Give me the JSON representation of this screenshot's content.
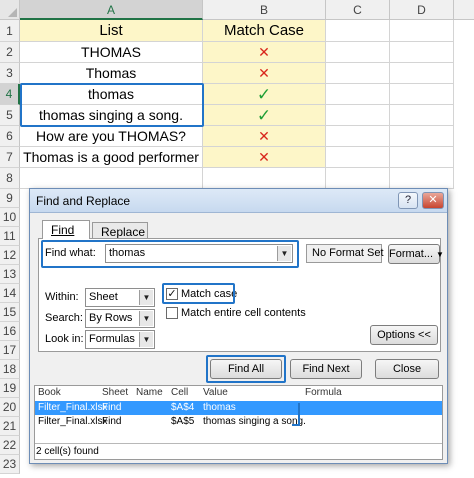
{
  "spreadsheet": {
    "columns": [
      "A",
      "B",
      "C",
      "D"
    ],
    "rows": [
      "1",
      "2",
      "3",
      "4",
      "5",
      "6",
      "7",
      "8",
      "9",
      "10",
      "11",
      "12",
      "13",
      "14",
      "15",
      "16",
      "17",
      "18",
      "19",
      "20",
      "21",
      "22",
      "23"
    ],
    "header": {
      "list": "List",
      "match_case": "Match Case"
    },
    "data": [
      {
        "text": "THOMAS",
        "mark": "✕"
      },
      {
        "text": "Thomas",
        "mark": "✕"
      },
      {
        "text": "thomas",
        "mark": "✓"
      },
      {
        "text": "thomas singing a song.",
        "mark": "✓"
      },
      {
        "text": "How are you THOMAS?",
        "mark": "✕"
      },
      {
        "text": "Thomas is a good performer",
        "mark": "✕"
      }
    ],
    "colors": {
      "cross": "#d9261c",
      "check": "#1f9e35",
      "highlight": "#2174c8",
      "yellow_fill": "#fdf6c8"
    }
  },
  "dialog": {
    "title": "Find and Replace",
    "help_glyph": "?",
    "close_glyph": "✕",
    "tabs": {
      "find": "Find",
      "replace": "Replace"
    },
    "find_what_label": "Find what:",
    "find_what_value": "thomas",
    "no_format_set": "No Format Set",
    "format_button": "Format...",
    "within_label": "Within:",
    "within_value": "Sheet",
    "search_label": "Search:",
    "search_value": "By Rows",
    "lookin_label": "Look in:",
    "lookin_value": "Formulas",
    "match_case_label": "Match case",
    "match_entire_label": "Match entire cell contents",
    "options_button": "Options <<",
    "find_all_button": "Find All",
    "find_next_button": "Find Next",
    "close_button": "Close",
    "results": {
      "columns": [
        "Book",
        "Sheet",
        "Name",
        "Cell",
        "Value",
        "Formula"
      ],
      "rows": [
        {
          "book": "Filter_Final.xlsx",
          "sheet": "Find",
          "name": "",
          "cell": "$A$4",
          "value": "thomas",
          "formula": ""
        },
        {
          "book": "Filter_Final.xlsx",
          "sheet": "Find",
          "name": "",
          "cell": "$A$5",
          "value": "thomas singing a song.",
          "formula": ""
        }
      ],
      "status": "2 cell(s) found"
    }
  }
}
